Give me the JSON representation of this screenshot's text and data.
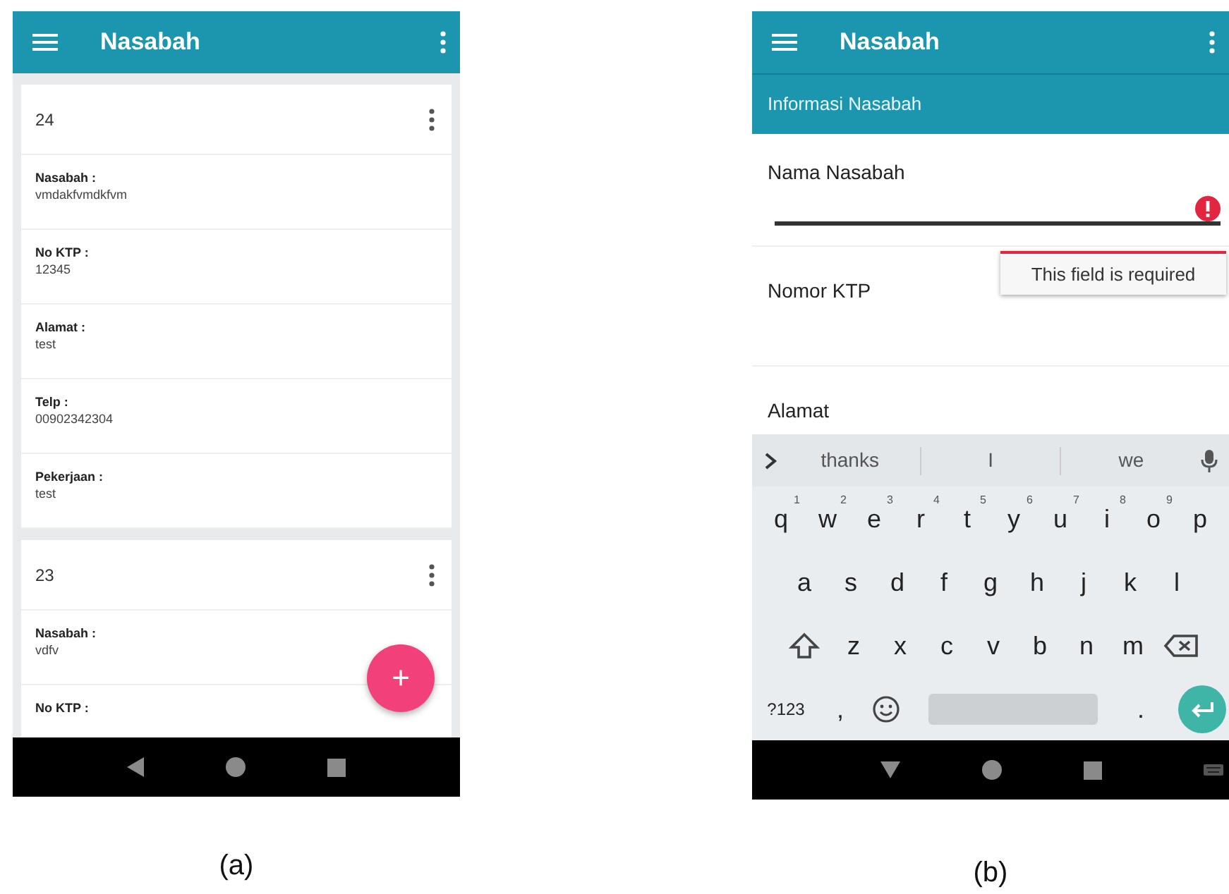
{
  "figures": [
    {
      "caption": "(a)",
      "keyboard_open": false,
      "app_bar": {
        "title": "Nasabah"
      },
      "cards": [
        {
          "number": "24",
          "fields": [
            {
              "label": "Nasabah :",
              "value": "vmdakfvmdkfvm"
            },
            {
              "label": "No KTP :",
              "value": "12345"
            },
            {
              "label": "Alamat :",
              "value": "test"
            },
            {
              "label": "Telp :",
              "value": "00902342304"
            },
            {
              "label": "Pekerjaan :",
              "value": "test"
            }
          ]
        },
        {
          "number": "23",
          "fields": [
            {
              "label": "Nasabah :",
              "value": "vdfv"
            },
            {
              "label": "No KTP :"
            }
          ]
        }
      ],
      "fab": {
        "label": "+"
      }
    },
    {
      "caption": "(b)",
      "keyboard_open": true,
      "app_bar": {
        "title": "Nasabah"
      },
      "section": "Informasi Nasabah",
      "form_fields": [
        {
          "label": "Nama Nasabah",
          "focused": true,
          "error": "This field is required"
        },
        {
          "label": "Nomor KTP",
          "focused": false
        },
        {
          "label": "Alamat",
          "focused": false
        }
      ],
      "keyboard": {
        "suggestions": [
          "thanks",
          "I",
          "we"
        ],
        "rows": [
          [
            {
              "kind": "letter",
              "label": "q",
              "hint": "1"
            },
            {
              "kind": "letter",
              "label": "w",
              "hint": "2"
            },
            {
              "kind": "letter",
              "label": "e",
              "hint": "3"
            },
            {
              "kind": "letter",
              "label": "r",
              "hint": "4"
            },
            {
              "kind": "letter",
              "label": "t",
              "hint": "5"
            },
            {
              "kind": "letter",
              "label": "y",
              "hint": "6"
            },
            {
              "kind": "letter",
              "label": "u",
              "hint": "7"
            },
            {
              "kind": "letter",
              "label": "i",
              "hint": "8"
            },
            {
              "kind": "letter",
              "label": "o",
              "hint": "9"
            },
            {
              "kind": "letter",
              "label": "p"
            }
          ],
          [
            {
              "kind": "letter",
              "label": "a"
            },
            {
              "kind": "letter",
              "label": "s"
            },
            {
              "kind": "letter",
              "label": "d"
            },
            {
              "kind": "letter",
              "label": "f"
            },
            {
              "kind": "letter",
              "label": "g"
            },
            {
              "kind": "letter",
              "label": "h"
            },
            {
              "kind": "letter",
              "label": "j"
            },
            {
              "kind": "letter",
              "label": "k"
            },
            {
              "kind": "letter",
              "label": "l"
            }
          ],
          [
            {
              "kind": "shift"
            },
            {
              "kind": "letter",
              "label": "z"
            },
            {
              "kind": "letter",
              "label": "x"
            },
            {
              "kind": "letter",
              "label": "c"
            },
            {
              "kind": "letter",
              "label": "v"
            },
            {
              "kind": "letter",
              "label": "b"
            },
            {
              "kind": "letter",
              "label": "n"
            },
            {
              "kind": "letter",
              "label": "m"
            },
            {
              "kind": "backspace"
            }
          ],
          [
            {
              "kind": "symbols",
              "label": "?123"
            },
            {
              "kind": "letter",
              "label": ","
            },
            {
              "kind": "emoji"
            },
            {
              "kind": "space"
            },
            {
              "kind": "letter",
              "label": "."
            },
            {
              "kind": "enter"
            }
          ]
        ]
      }
    }
  ]
}
